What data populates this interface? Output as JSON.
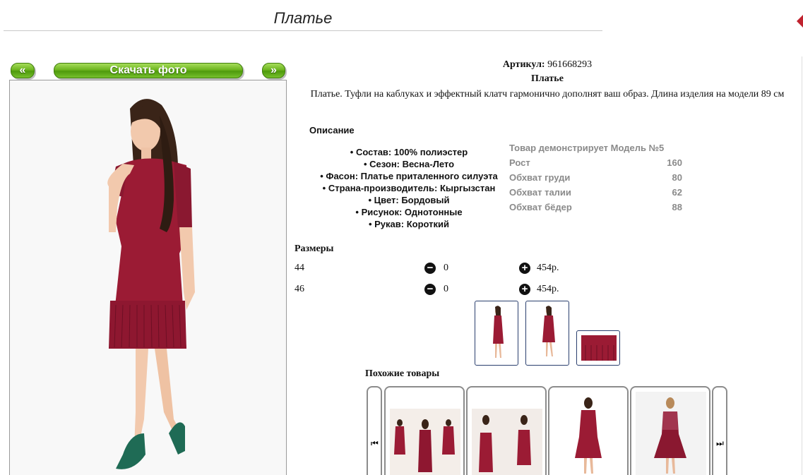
{
  "page": {
    "title": "Платье"
  },
  "photo_nav": {
    "prev_label": "«",
    "download_label": "Скачать фото",
    "next_label": "»"
  },
  "product": {
    "sku_label": "Артикул:",
    "sku_value": "961668293",
    "name": "Платье",
    "description": "Платье. Туфли на каблуках и эффектный клатч гармонично дополнят ваш образ. Длина изделия на модели 89 см"
  },
  "description_section": {
    "heading": "Описание",
    "attributes": [
      "Состав: 100% полиэстер",
      "Сезон: Весна-Лето",
      "Фасон: Платье приталенного силуэта",
      "Страна-производитель: Кыргызстан",
      "Цвет: Бордовый",
      "Рисунок: Однотонные",
      "Рукав: Короткий"
    ]
  },
  "model_info": {
    "heading": "Товар демонстрирует Модель №5",
    "rows": [
      {
        "label": "Рост",
        "value": "160"
      },
      {
        "label": "Обхват груди",
        "value": "80"
      },
      {
        "label": "Обхват талии",
        "value": "62"
      },
      {
        "label": "Обхват бёдер",
        "value": "88"
      }
    ]
  },
  "sizes": {
    "heading": "Размеры",
    "minus_glyph": "−",
    "plus_glyph": "+",
    "rows": [
      {
        "size": "44",
        "qty": "0",
        "price": "454р."
      },
      {
        "size": "46",
        "qty": "0",
        "price": "454р."
      }
    ]
  },
  "similar": {
    "heading": "Похожие товары",
    "prev_glyph": "⏮",
    "next_glyph": "⏭"
  },
  "colors": {
    "dress": "#9b1b34",
    "dress_dark": "#7a1228",
    "button_green": "#6cb51f",
    "thumb_border": "#2a3f6e"
  }
}
